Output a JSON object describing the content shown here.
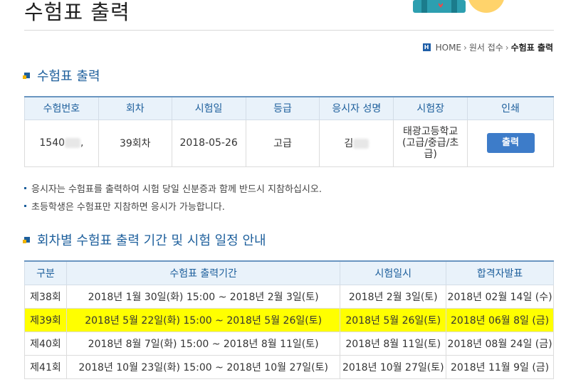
{
  "header": {
    "title": "수험표 출력"
  },
  "breadcrumb": {
    "home": "HOME",
    "step1": "원서 접수",
    "current": "수험표 출력"
  },
  "section1": {
    "title": "수험표 출력",
    "columns": [
      "수험번호",
      "회차",
      "시험일",
      "등급",
      "응시자 성명",
      "시험장",
      "인쇄"
    ],
    "row": {
      "number": "1540",
      "suffix": ",",
      "round": "39회차",
      "date": "2018-05-26",
      "grade": "고급",
      "name": "김",
      "venue_line1": "태광고등학교",
      "venue_line2": "(고급/중급/초",
      "venue_line3": "급)",
      "print_label": "출력"
    }
  },
  "notes": [
    "응시자는 수험표를 출력하여 시험 당일 신분증과 함께 반드시 지참하십시오.",
    "초등학생은 수험표만 지참하면 응시가 가능합니다."
  ],
  "section2": {
    "title": "회차별 수험표 출력 기간 및 시험 일정 안내",
    "columns": [
      "구분",
      "수험표 출력기간",
      "시험일시",
      "합격자발표"
    ],
    "rows": [
      {
        "round": "제38회",
        "period": "2018년 1월 30일(화) 15:00 ~ 2018년 2월 3일(토)",
        "exam": "2018년 2월 3일(토)",
        "result": "2018년 02월 14일 (수)"
      },
      {
        "round": "제39회",
        "period": "2018년 5월 22일(화) 15:00 ~ 2018년 5월 26일(토)",
        "exam": "2018년 5월 26일(토)",
        "result": "2018년 06월 8일 (금)"
      },
      {
        "round": "제40회",
        "period": "2018년 8월 7일(화) 15:00 ~ 2018년 8월 11일(토)",
        "exam": "2018년 8월 11일(토)",
        "result": "2018년 08월 24일 (금)"
      },
      {
        "round": "제41회",
        "period": "2018년 10월 23일(화) 15:00 ~ 2018년 10월 27일(토)",
        "exam": "2018년 10월 27일(토)",
        "result": "2018년 11월 9일 (금)"
      }
    ]
  },
  "colors": {
    "accent": "#1d5f9c",
    "highlight": "#ffff00",
    "button": "#3d7cc9"
  }
}
